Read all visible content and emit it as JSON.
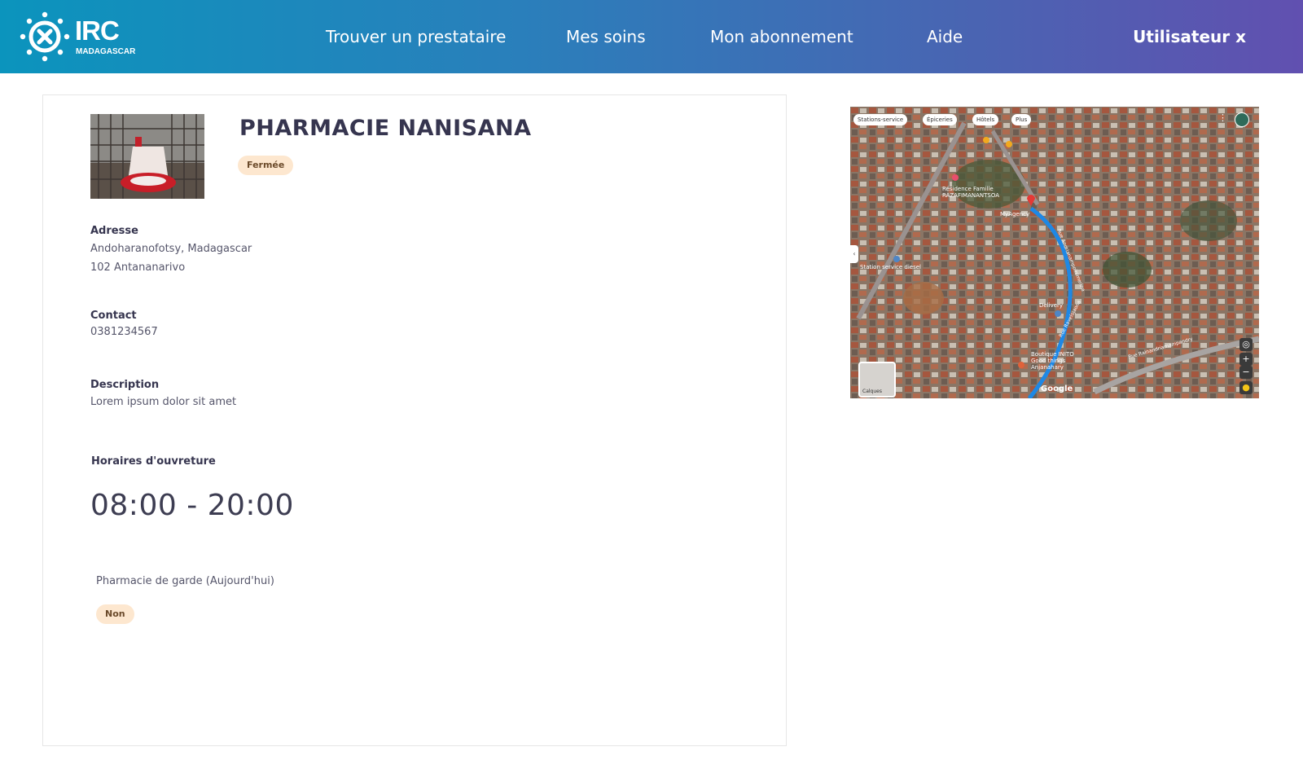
{
  "brand": {
    "name": "IRC",
    "subtitle": "MADAGASCAR"
  },
  "nav": {
    "items": [
      {
        "label": "Trouver un prestataire"
      },
      {
        "label": "Mes soins"
      },
      {
        "label": "Mon abonnement"
      },
      {
        "label": "Aide"
      }
    ],
    "user": "Utilisateur x"
  },
  "colors": {
    "header_start": "#0b94bd",
    "header_end": "#6150b0",
    "badge_bg": "#fde7cf",
    "title": "#36354f"
  },
  "pharmacy": {
    "name": "PHARMACIE NANISANA",
    "status": "Fermée",
    "address_label": "Adresse",
    "address_line1": "Andoharanofotsy, Madagascar",
    "address_line2": "102 Antananarivo",
    "contact_label": "Contact",
    "phone": "0381234567",
    "description_label": "Description",
    "description": "Lorem ipsum dolor sit amet",
    "hours_label": "Horaires d'ouvreture",
    "hours": "08:00 - 20:00",
    "on_duty_label": "Pharmacie de garde (Aujourd'hui)",
    "on_duty": "Non"
  },
  "map": {
    "chips": [
      "Stations-service",
      "Épiceries",
      "Hôtels",
      "Plus"
    ],
    "labels": {
      "residence": "Résidence Famille RAZAFIMANANTSOA",
      "agency": "MyAgency",
      "station": "Station service diesel",
      "delivery": "Delivery",
      "shop": "Boutique INITO Good things Anjanahary",
      "road1": "Rue Andrianampoinimerina",
      "road2": "Rue Ravelojaona",
      "road3": "Rue Rainandriamampandry",
      "google": "Google",
      "layers": "Calques"
    }
  }
}
